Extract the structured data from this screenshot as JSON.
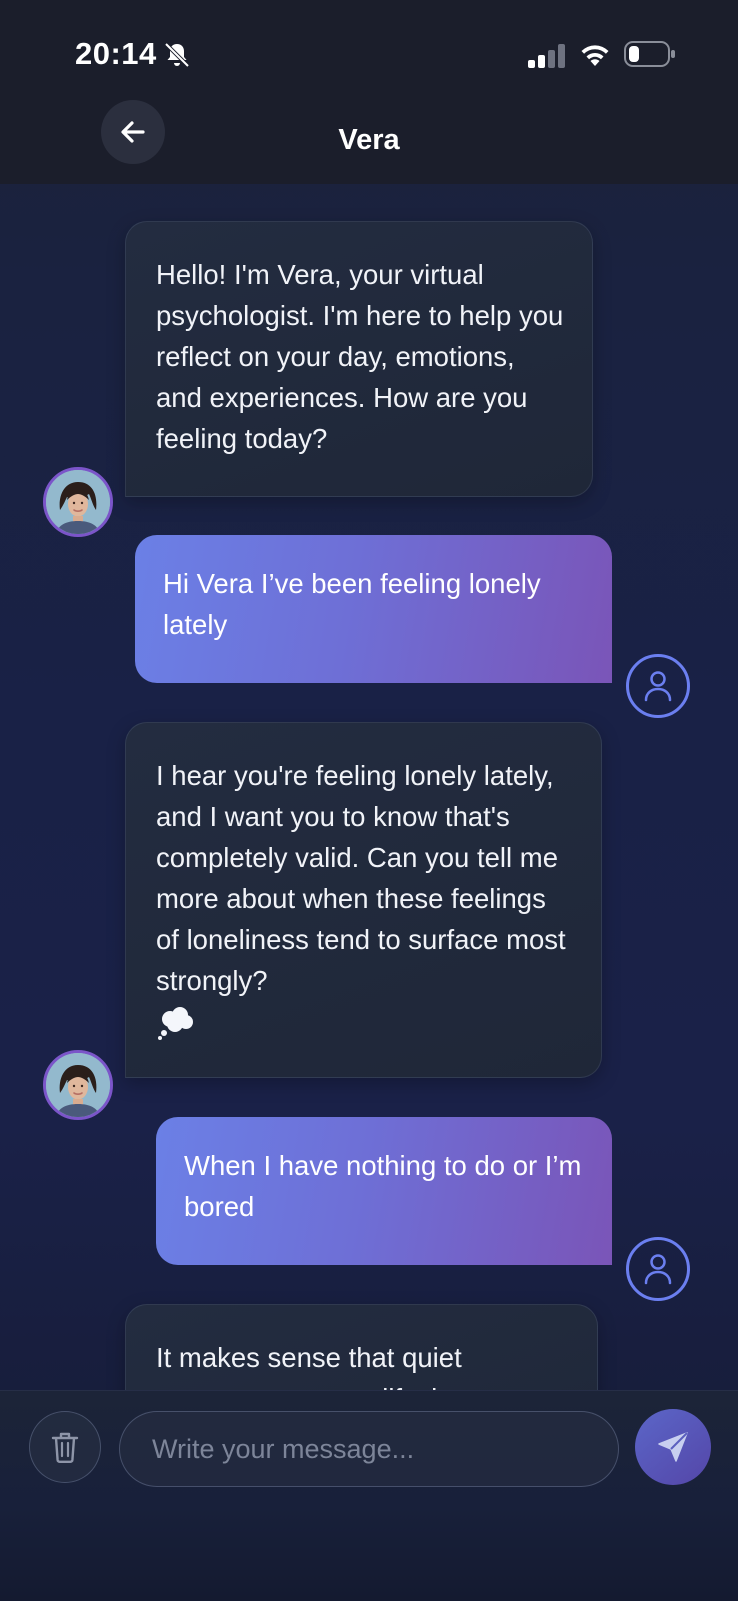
{
  "status_bar": {
    "time": "20:14",
    "icons": [
      "bell-slash-icon",
      "cellular-signal-icon",
      "wifi-icon",
      "battery-icon"
    ]
  },
  "header": {
    "title": "Vera",
    "back_icon": "arrow-left-icon"
  },
  "messages": [
    {
      "sender": "Vera",
      "text": "Hello! I'm Vera, your virtual psychologist. I'm here to help you reflect on your day, emotions, and experiences. How are you feeling today?"
    },
    {
      "sender": "user",
      "text": "Hi Vera I’ve been feeling lonely lately"
    },
    {
      "sender": "Vera",
      "text": "I hear you're feeling lonely lately, and I want you to know that's completely valid. Can you tell me more about when these feelings of loneliness tend to surface most strongly?",
      "emoji": "thought-balloon-icon"
    },
    {
      "sender": "user",
      "text": "When I have nothing to do or I’m bored"
    },
    {
      "sender": "Vera",
      "text": "It makes sense that quiet moments can amplify those"
    }
  ],
  "composer": {
    "placeholder": "Write your message...",
    "value": "",
    "trash_icon": "trash-icon",
    "send_icon": "send-icon"
  },
  "colors": {
    "user_bubble_start": "#6b80e6",
    "user_bubble_end": "#7a55b8",
    "vera_bubble": "#232c40",
    "user_avatar_ring": "#6b7ff0",
    "vera_avatar_ring": "#7b55c9",
    "send_button": "#5446a8"
  }
}
